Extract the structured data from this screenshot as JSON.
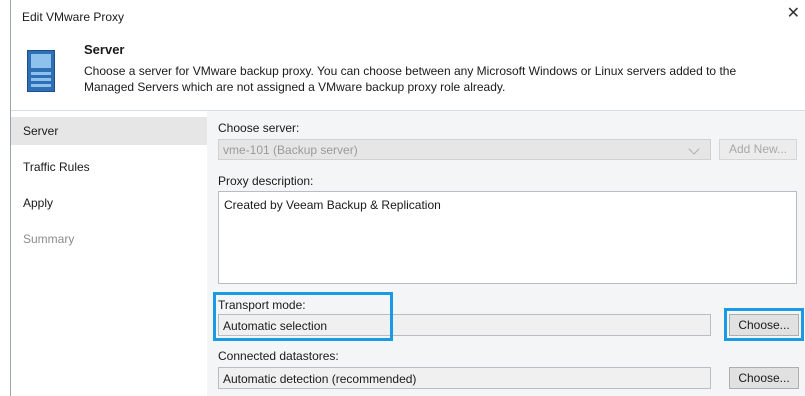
{
  "window": {
    "title": "Edit VMware Proxy",
    "close_glyph": "✕"
  },
  "header": {
    "title": "Server",
    "description": "Choose a server for VMware backup proxy. You can choose between any Microsoft Windows or Linux servers added to the Managed Servers which are not assigned a VMware backup proxy role already.",
    "icon": "server-icon"
  },
  "nav": {
    "items": [
      {
        "label": "Server",
        "state": "active"
      },
      {
        "label": "Traffic Rules",
        "state": "normal"
      },
      {
        "label": "Apply",
        "state": "normal"
      },
      {
        "label": "Summary",
        "state": "disabled"
      }
    ]
  },
  "form": {
    "choose_server": {
      "label": "Choose server:",
      "value": "vme-101 (Backup server)",
      "add_new_label": "Add New..."
    },
    "proxy_description": {
      "label": "Proxy description:",
      "value": "Created by Veeam Backup & Replication"
    },
    "transport_mode": {
      "label": "Transport mode:",
      "value": "Automatic selection",
      "button_label": "Choose..."
    },
    "connected_datastores": {
      "label": "Connected datastores:",
      "value": "Automatic detection (recommended)",
      "button_label": "Choose..."
    }
  },
  "colors": {
    "highlight": "#1a9ae5",
    "nav_active": "#e6e6e6",
    "content_bg": "#f4f5f7"
  }
}
